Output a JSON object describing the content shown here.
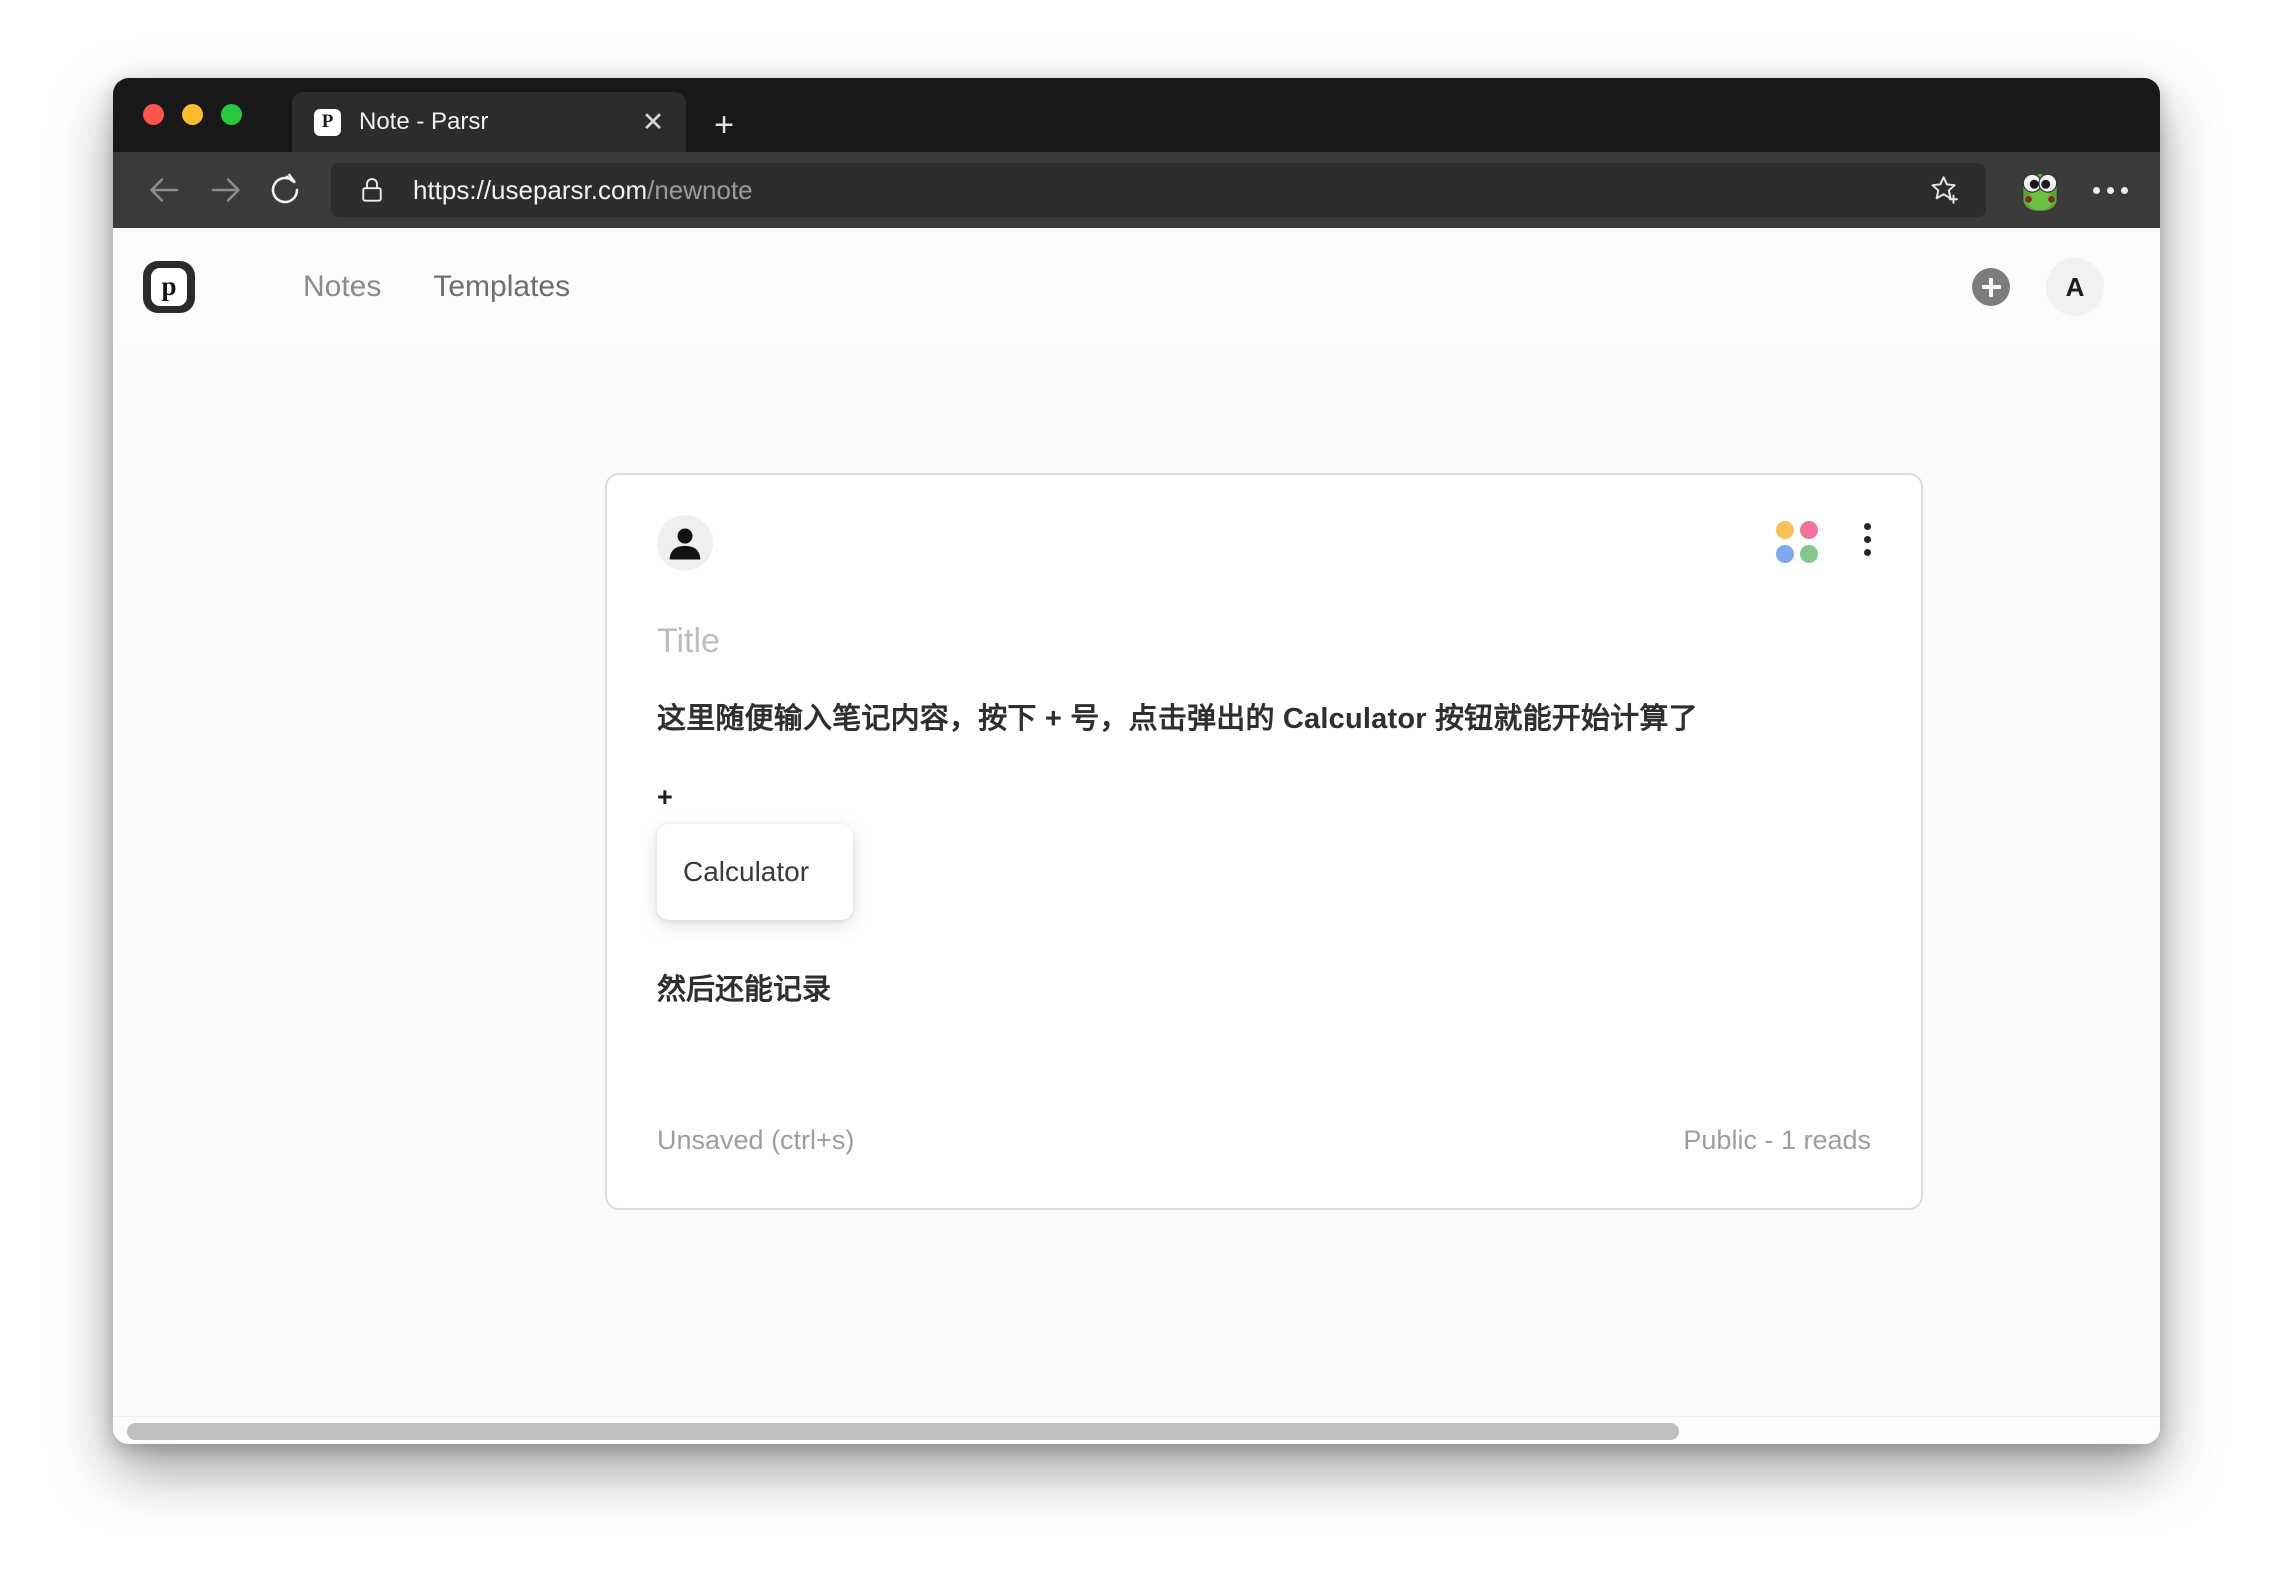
{
  "browser": {
    "traffic_lights": [
      {
        "name": "close",
        "color": "#FB564E"
      },
      {
        "name": "minimize",
        "color": "#FDBC2E"
      },
      {
        "name": "maximize",
        "color": "#28C83F"
      }
    ],
    "tab": {
      "favicon_letter": "P",
      "title": "Note - Parsr",
      "close_glyph": "✕"
    },
    "new_tab_glyph": "+",
    "nav": {
      "back_icon": "back-arrow-icon",
      "forward_icon": "forward-arrow-icon",
      "reload_icon": "reload-icon"
    },
    "url": {
      "lock_icon": "lock-icon",
      "origin": "https://useparsr.com",
      "path": "/newnote"
    },
    "star_icon": "bookmark-star-add-icon",
    "extension_icon": "frog-avatar-icon",
    "overflow_menu": "three-dots-icon"
  },
  "app": {
    "logo_letter": "p",
    "nav_links": [
      {
        "label": "Notes"
      },
      {
        "label": "Templates"
      }
    ],
    "add_button_glyph": "+",
    "avatar_letter": "A"
  },
  "note": {
    "author_avatar_icon": "person-avatar-icon",
    "color_dots": [
      {
        "name": "yellow",
        "color": "#F7C15C"
      },
      {
        "name": "pink",
        "color": "#F0739A"
      },
      {
        "name": "blue",
        "color": "#7EA9F0"
      },
      {
        "name": "green",
        "color": "#82C88A"
      }
    ],
    "kebab_icon": "more-vertical-icon",
    "title_placeholder": "Title",
    "title_value": "",
    "body_line_1": "这里随便输入笔记内容，按下 + 号，点击弹出的 Calculator 按钮就能开始计算了",
    "plus_marker": "+",
    "popup_items": [
      {
        "label": "Calculator"
      }
    ],
    "body_line_2": "然后还能记录",
    "footer_left": "Unsaved (ctrl+s)",
    "footer_right": "Public - 1 reads"
  }
}
